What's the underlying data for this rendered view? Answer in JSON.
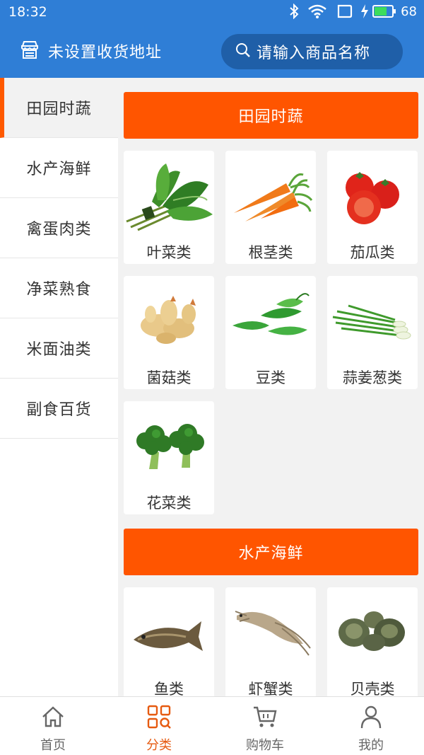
{
  "status": {
    "time": "18:32",
    "battery": "68"
  },
  "header": {
    "address": "未设置收货地址",
    "search_placeholder": "请输入商品名称"
  },
  "sidebar": {
    "items": [
      {
        "label": "田园时蔬",
        "active": true
      },
      {
        "label": "水产海鲜",
        "active": false
      },
      {
        "label": "禽蛋肉类",
        "active": false
      },
      {
        "label": "净菜熟食",
        "active": false
      },
      {
        "label": "米面油类",
        "active": false
      },
      {
        "label": "副食百货",
        "active": false
      }
    ]
  },
  "sections": [
    {
      "title": "田园时蔬",
      "items": [
        {
          "label": "叶菜类",
          "icon": "leafy-greens-icon"
        },
        {
          "label": "根茎类",
          "icon": "carrot-icon"
        },
        {
          "label": "茄瓜类",
          "icon": "tomato-icon"
        },
        {
          "label": "菌菇类",
          "icon": "ginger-icon"
        },
        {
          "label": "豆类",
          "icon": "pea-pod-icon"
        },
        {
          "label": "蒜姜葱类",
          "icon": "scallion-icon"
        },
        {
          "label": "花菜类",
          "icon": "broccoli-icon"
        }
      ]
    },
    {
      "title": "水产海鲜",
      "items": [
        {
          "label": "鱼类",
          "icon": "fish-icon"
        },
        {
          "label": "虾蟹类",
          "icon": "shrimp-icon"
        },
        {
          "label": "贝壳类",
          "icon": "snail-shell-icon"
        }
      ]
    }
  ],
  "bottom_nav": {
    "items": [
      {
        "label": "首页",
        "icon": "home-icon",
        "active": false
      },
      {
        "label": "分类",
        "icon": "category-icon",
        "active": true
      },
      {
        "label": "购物车",
        "icon": "cart-icon",
        "active": false
      },
      {
        "label": "我的",
        "icon": "user-icon",
        "active": false
      }
    ]
  },
  "colors": {
    "header": "#2f7ed6",
    "accent": "#ff5500",
    "active_nav": "#e65a10"
  }
}
